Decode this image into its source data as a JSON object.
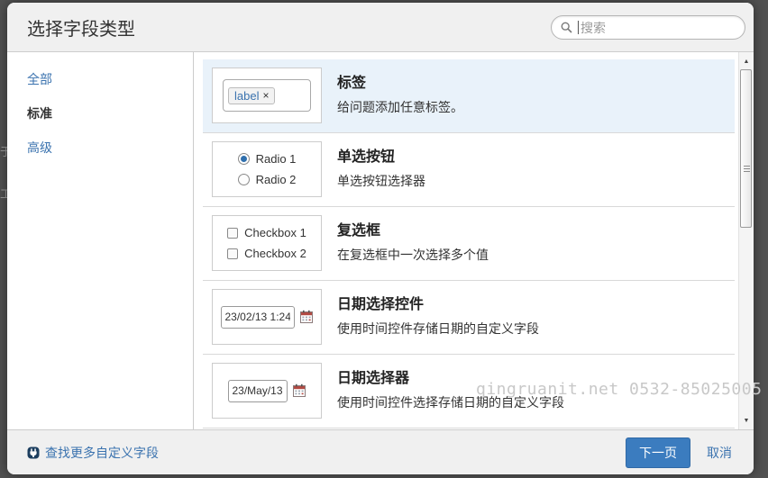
{
  "modal": {
    "title": "选择字段类型",
    "search": {
      "placeholder": "搜索"
    },
    "sidebar": {
      "items": [
        {
          "label": "全部"
        },
        {
          "label": "标准"
        },
        {
          "label": "高级"
        }
      ]
    },
    "rows": [
      {
        "title": "标签",
        "description": "给问题添加任意标签。",
        "preview": {
          "type": "labels",
          "label_text": "label",
          "remove_glyph": "×"
        }
      },
      {
        "title": "单选按钮",
        "description": "单选按钮选择器",
        "preview": {
          "type": "radio",
          "options": [
            "Radio 1",
            "Radio 2"
          ],
          "selected_option": "Radio 1"
        }
      },
      {
        "title": "复选框",
        "description": "在复选框中一次选择多个值",
        "preview": {
          "type": "checkbox",
          "options": [
            "Checkbox 1",
            "Checkbox 2"
          ]
        }
      },
      {
        "title": "日期选择控件",
        "description": "使用时间控件存储日期的自定义字段",
        "preview": {
          "type": "datetime",
          "value": "23/02/13 1:24"
        }
      },
      {
        "title": "日期选择器",
        "description": "使用时间控件选择存储日期的自定义字段",
        "preview": {
          "type": "date",
          "value": "23/May/13"
        }
      }
    ],
    "footer": {
      "more_link": "查找更多自定义字段",
      "next_button": "下一页",
      "cancel_link": "取消"
    }
  },
  "scrollbar": {
    "up_glyph": "▲",
    "down_glyph": "▼"
  },
  "watermark": "qingruanit.net 0532-85025005",
  "icons": {
    "search-icon": "magnifier",
    "calendar-icon": "calendar-grid",
    "marketplace-icon": "addon-plug"
  },
  "colors": {
    "link": "#3b73af",
    "primary_button": "#3b7cbf",
    "selected_row_bg": "#e9f2fa",
    "backdrop": "#515151"
  }
}
